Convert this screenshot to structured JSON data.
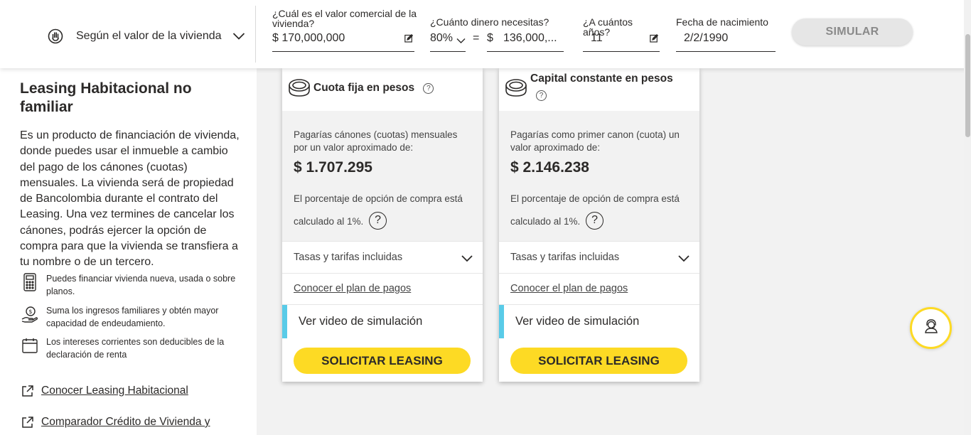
{
  "topbar": {
    "mode_label": "Según el valor de la vivienda",
    "value_field": {
      "label": "¿Cuál es el valor comercial de la vivienda?",
      "value": "$ 170,000,000"
    },
    "money_field": {
      "label": "¿Cuánto dinero necesitas?",
      "percent": "80%",
      "equals": "=",
      "currency": "$",
      "value": "136,000,..."
    },
    "years_field": {
      "label": "¿A cuántos años?",
      "value": "11"
    },
    "birth_field": {
      "label": "Fecha de nacimiento",
      "value": "2/2/1990"
    },
    "simulate_label": "SIMULAR"
  },
  "left_panel": {
    "title": "Leasing Habitacional no familiar",
    "description": "Es un producto de financiación de vivienda, donde puedes usar el inmueble a cambio del pago de los cánones (cuotas) mensuales. La vivienda será de propiedad de Bancolombia durante el contrato del Leasing. Una vez termines de cancelar los cánones, podrás ejercer la opción de compra para que la vivienda se transfiera a tu nombre o de un tercero.",
    "benefits": [
      {
        "icon": "calculator-icon",
        "text": "Puedes financiar vivienda nueva, usada o sobre planos."
      },
      {
        "icon": "money-hand-icon",
        "text": "Suma los ingresos familiares y obtén mayor capacidad de endeudamiento."
      },
      {
        "icon": "calendar-icon",
        "text": "Los intereses corrientes son deducibles de la declaración de renta"
      }
    ],
    "links": [
      {
        "icon": "external-link-icon",
        "text": "Conocer Leasing Habitacional"
      },
      {
        "icon": "external-link-icon",
        "text": "Comparador Crédito de Vivienda y"
      }
    ]
  },
  "cards": [
    {
      "title": "Cuota fija en pesos",
      "text": "Pagarías cánones (cuotas) mensuales por un valor aproximado de:",
      "amount": "$ 1.707.295",
      "pct_text": "El porcentaje de opción de compra está calculado al 1%.",
      "rates_label": "Tasas y tarifas incluidas",
      "plan_link": "Conocer el plan de pagos",
      "video_label": "Ver video de simulación",
      "cta": "SOLICITAR LEASING"
    },
    {
      "title": "Capital constante en pesos",
      "text": "Pagarías como primer canon (cuota) un valor aproximado de:",
      "amount": "$ 2.146.238",
      "pct_text": "El porcentaje de opción de compra está calculado al 1%.",
      "rates_label": "Tasas y tarifas incluidas",
      "plan_link": "Conocer el plan de pagos",
      "video_label": "Ver video de simulación",
      "cta": "SOLICITAR LEASING"
    }
  ],
  "glyphs": {
    "help_small": "?",
    "help_large": "?"
  },
  "colors": {
    "accent_yellow": "#fdda24",
    "video_bar": "#59cbe8",
    "text_dark": "#2c2a29",
    "panel_gray": "#f2f2f2"
  }
}
